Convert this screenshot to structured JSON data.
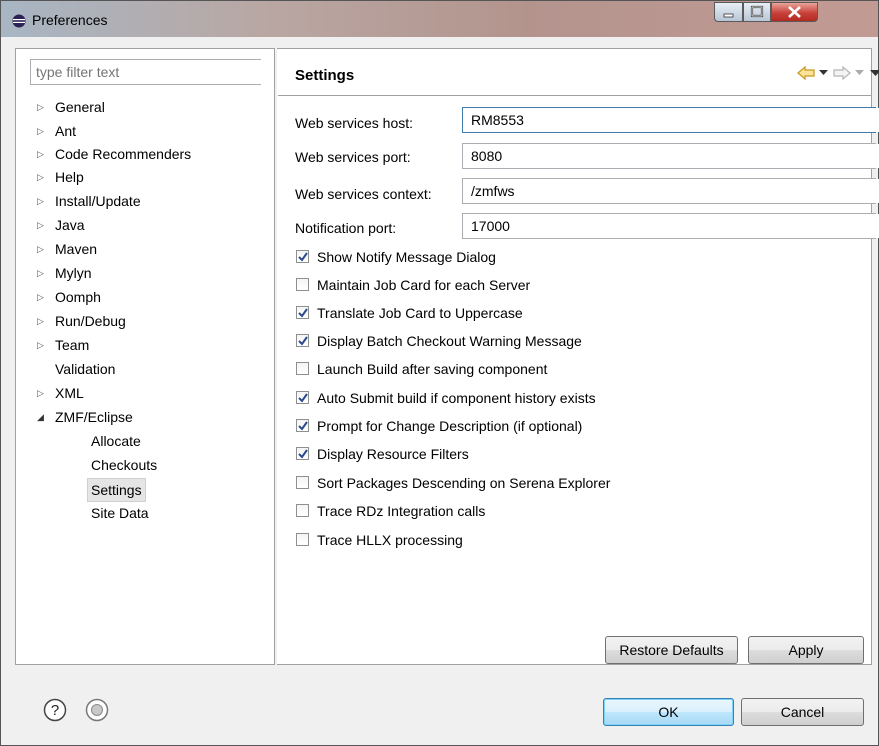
{
  "window": {
    "title": "Preferences"
  },
  "filter": {
    "placeholder": "type filter text"
  },
  "tree": {
    "items": [
      {
        "label": "General",
        "expandable": true,
        "expanded": false
      },
      {
        "label": "Ant",
        "expandable": true,
        "expanded": false
      },
      {
        "label": "Code Recommenders",
        "expandable": true,
        "expanded": false
      },
      {
        "label": "Help",
        "expandable": true,
        "expanded": false
      },
      {
        "label": "Install/Update",
        "expandable": true,
        "expanded": false
      },
      {
        "label": "Java",
        "expandable": true,
        "expanded": false
      },
      {
        "label": "Maven",
        "expandable": true,
        "expanded": false
      },
      {
        "label": "Mylyn",
        "expandable": true,
        "expanded": false
      },
      {
        "label": "Oomph",
        "expandable": true,
        "expanded": false
      },
      {
        "label": "Run/Debug",
        "expandable": true,
        "expanded": false
      },
      {
        "label": "Team",
        "expandable": true,
        "expanded": false
      },
      {
        "label": "Validation",
        "expandable": false,
        "expanded": false
      },
      {
        "label": "XML",
        "expandable": true,
        "expanded": false
      },
      {
        "label": "ZMF/Eclipse",
        "expandable": true,
        "expanded": true
      },
      {
        "label": "Allocate",
        "child": true
      },
      {
        "label": "Checkouts",
        "child": true
      },
      {
        "label": "Settings",
        "child": true,
        "selected": true
      },
      {
        "label": "Site Data",
        "child": true
      }
    ]
  },
  "page": {
    "title": "Settings",
    "fields": [
      {
        "label": "Web services host:",
        "value": "RM8553"
      },
      {
        "label": "Web services port:",
        "value": "8080"
      },
      {
        "label": "Web services context:",
        "value": "/zmfws"
      },
      {
        "label": "Notification port:",
        "value": "17000"
      }
    ],
    "checkboxes": [
      {
        "label": "Show Notify Message Dialog",
        "checked": true
      },
      {
        "label": "Maintain Job Card for each Server",
        "checked": false
      },
      {
        "label": "Translate Job Card to Uppercase",
        "checked": true
      },
      {
        "label": "Display Batch Checkout Warning Message",
        "checked": true
      },
      {
        "label": "Launch Build after saving component",
        "checked": false
      },
      {
        "label": "Auto Submit build if component history exists",
        "checked": true
      },
      {
        "label": "Prompt for Change Description (if optional)",
        "checked": true
      },
      {
        "label": "Display Resource Filters",
        "checked": true
      },
      {
        "label": "Sort Packages Descending on Serena Explorer",
        "checked": false
      },
      {
        "label": "Trace RDz Integration calls",
        "checked": false
      },
      {
        "label": "Trace HLLX processing",
        "checked": false
      }
    ],
    "restore_defaults_label": "Restore Defaults",
    "apply_label": "Apply"
  },
  "footer": {
    "ok_label": "OK",
    "cancel_label": "Cancel"
  },
  "icons": {
    "back": "back-arrow-icon",
    "forward": "forward-arrow-icon",
    "help": "help-icon",
    "import_export": "import-export-icon"
  },
  "colors": {
    "accent": "#3c7fb1",
    "back_arrow": "#e0a31b",
    "close_button": "#c8423a"
  }
}
